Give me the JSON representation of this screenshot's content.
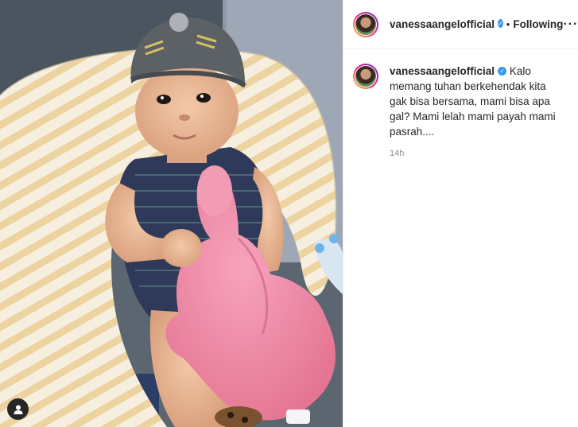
{
  "post": {
    "username": "vanessaangelofficial",
    "verified_icon": "verified-badge-icon",
    "separator": "•",
    "follow_status": "Following",
    "more_icon": "more-options-icon",
    "more_label": "···",
    "caption": "Kalo memang tuhan berkehendak kita gak bisa bersama, mami bisa apa gal? Mami lelah mami payah mami pasrah....",
    "timestamp": "14h",
    "user_tag_icon": "user-tag-icon"
  },
  "colors": {
    "verified": "#3897f0",
    "text": "#262626",
    "muted": "#8e8e8e",
    "border": "#efefef"
  }
}
